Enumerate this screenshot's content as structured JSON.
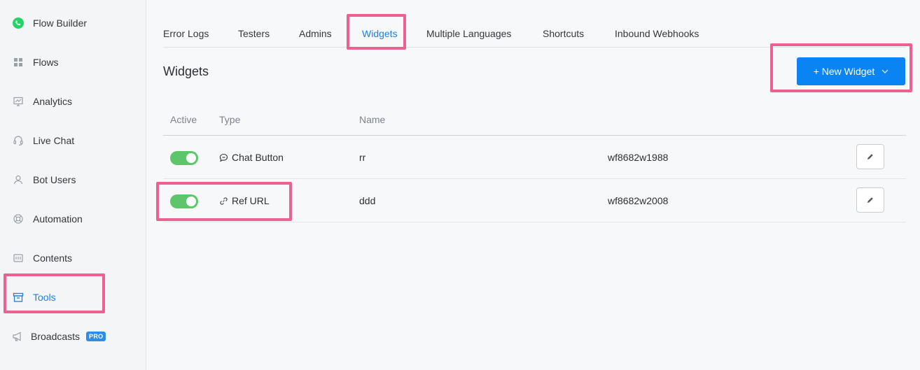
{
  "colors": {
    "accent": "#1b7fe0",
    "primary_button": "#0b84f3",
    "toggle_on": "#5ec66a",
    "highlight": "#ee6090",
    "whatsapp": "#25d366"
  },
  "sidebar": {
    "items": [
      {
        "label": "Flow Builder",
        "icon": "whatsapp-icon",
        "active": false
      },
      {
        "label": "Flows",
        "icon": "grid-icon",
        "active": false
      },
      {
        "label": "Analytics",
        "icon": "presentation-chart-icon",
        "active": false
      },
      {
        "label": "Live Chat",
        "icon": "headset-icon",
        "active": false
      },
      {
        "label": "Bot Users",
        "icon": "user-icon",
        "active": false
      },
      {
        "label": "Automation",
        "icon": "lifebuoy-icon",
        "active": false
      },
      {
        "label": "Contents",
        "icon": "content-box-icon",
        "active": false
      },
      {
        "label": "Tools",
        "icon": "archive-box-icon",
        "active": true
      },
      {
        "label": "Broadcasts",
        "icon": "megaphone-icon",
        "active": false,
        "badge": "PRO"
      }
    ]
  },
  "tabs": [
    {
      "label": "Error Logs",
      "active": false
    },
    {
      "label": "Testers",
      "active": false
    },
    {
      "label": "Admins",
      "active": false
    },
    {
      "label": "Widgets",
      "active": true
    },
    {
      "label": "Multiple Languages",
      "active": false
    },
    {
      "label": "Shortcuts",
      "active": false
    },
    {
      "label": "Inbound Webhooks",
      "active": false
    }
  ],
  "page": {
    "title": "Widgets",
    "new_button_label": "+ New Widget"
  },
  "table": {
    "columns": [
      "Active",
      "Type",
      "Name"
    ],
    "rows": [
      {
        "active": true,
        "type": "Chat Button",
        "type_icon": "chat-bubble-icon",
        "name": "rr",
        "id": "wf8682w1988"
      },
      {
        "active": true,
        "type": "Ref URL",
        "type_icon": "link-icon",
        "name": "ddd",
        "id": "wf8682w2008"
      }
    ]
  }
}
